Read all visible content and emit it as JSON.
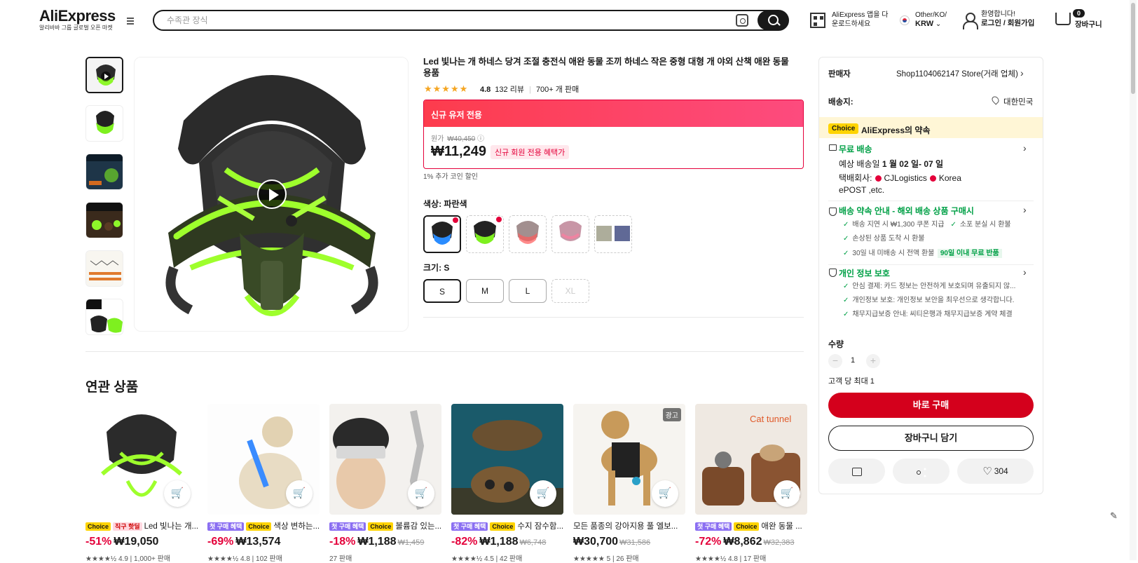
{
  "header": {
    "logo": "AliExpress",
    "logo_sub": "알리바바 그룹 글로벌 오픈 마켓",
    "search_placeholder": "수족관 장식",
    "app_line1": "AliExpress 앱을 다",
    "app_line2": "운로드하세요",
    "lang_line1": "Other/KO/",
    "lang_line2": "KRW",
    "user_line1": "환영합니다!",
    "user_line2": "로그인 / 회원가입",
    "cart_count": "0",
    "cart_label": "장바구니"
  },
  "product": {
    "title": "Led 빛나는 개 하네스 당겨 조절 충전식 애완 동물 조끼 하네스 작은 중형 대형 개 야외 산책 애완 동물 용품",
    "stars": "★★★★★",
    "rating": "4.8",
    "reviews": "132 리뷰",
    "sold": "700+ 개 판매",
    "new_user_banner": "신규 유저 전용",
    "orig_label": "원가",
    "orig_price": "₩40,450",
    "price": "₩11,249",
    "new_user_tag": "신규 회원 전용 혜택가",
    "coin_note": "1% 추가 코인 할인",
    "color_label": "색상: 파란색",
    "size_label": "크기: S",
    "sizes": [
      "S",
      "M",
      "L",
      "XL"
    ]
  },
  "panel": {
    "seller_label": "판매자",
    "seller_value": "Shop1104062147 Store(거래 업체)",
    "ship_label": "배송지:",
    "ship_value": "대한민국",
    "choice_tag": "Choice",
    "choice_text": "AliExpress의 약속",
    "free_ship": "무료 배송",
    "delivery_prefix": "예상 배송일",
    "delivery_date": "1 월 02 일- 07 일",
    "courier_prefix": "택배회사:",
    "courier_1": "CJLogistics",
    "courier_2": "Korea",
    "courier_3": "ePOST ,etc.",
    "promise_title": "배송 약속 안내 - 해외 배송 상품 구매시",
    "promise_1": "배송 지연 시 ₩1,300 쿠폰 지급",
    "promise_2": "소포 분실 시 환불",
    "promise_3": "손상된 상품 도착 시 환불",
    "promise_4": "30일 내 미배송 시 전액 환불",
    "promise_badge": "90일 이내 무료 반품",
    "privacy_title": "개인 정보 보호",
    "privacy_1": "안심 결제: 카드 정보는 안전하게 보호되며 유출되지 않...",
    "privacy_2": "개인정보 보호: 개인정보 보안을 최우선으로 생각합니다.",
    "privacy_3": "채무지급보증 안내: 씨티은행과 채무지급보증 계약 체결",
    "qty_label": "수량",
    "qty_minus": "−",
    "qty_value": "1",
    "qty_plus": "+",
    "qty_max": "고객 당 최대 1",
    "buy_now": "바로 구매",
    "add_cart": "장바구니 담기",
    "wish_count": "304"
  },
  "related": {
    "title": "연관 상품",
    "items": [
      {
        "tag1": "Choice",
        "tag2": "직구 핫딜",
        "name": "Led 빛나는 개...",
        "discount": "-51%",
        "price": "₩19,050",
        "orig": "",
        "stats": "★★★★½ 4.9 | 1,000+ 판매"
      },
      {
        "tag1": "첫 구매 혜택",
        "tag2": "Choice",
        "name": "색상 변하는...",
        "discount": "-69%",
        "price": "₩13,574",
        "orig": "",
        "stats": "★★★★½ 4.8 | 102 판매"
      },
      {
        "tag1": "첫 구매 혜택",
        "tag2": "Choice",
        "name": "볼륨감 있는...",
        "discount": "-18%",
        "price": "₩1,188",
        "orig": "₩1,459",
        "stats": "27 판매"
      },
      {
        "tag1": "첫 구매 혜택",
        "tag2": "Choice",
        "name": "수지 잠수함...",
        "discount": "-82%",
        "price": "₩1,188",
        "orig": "₩6,748",
        "stats": "★★★★½ 4.5 | 42 판매"
      },
      {
        "tag1": "",
        "tag2": "",
        "name": "모든 품종의 강아지용 풀 엘보...",
        "discount": "",
        "price": "₩30,700",
        "orig": "₩31,586",
        "stats": "★★★★★ 5 | 26 판매",
        "ad": "광고"
      },
      {
        "tag1": "첫 구매 혜택",
        "tag2": "Choice",
        "name": "애완 동물 ...",
        "discount": "-72%",
        "price": "₩8,862",
        "orig": "₩32,383",
        "stats": "★★★★½ 4.8 | 17 판매",
        "img_text": "Cat tunnel"
      }
    ]
  }
}
